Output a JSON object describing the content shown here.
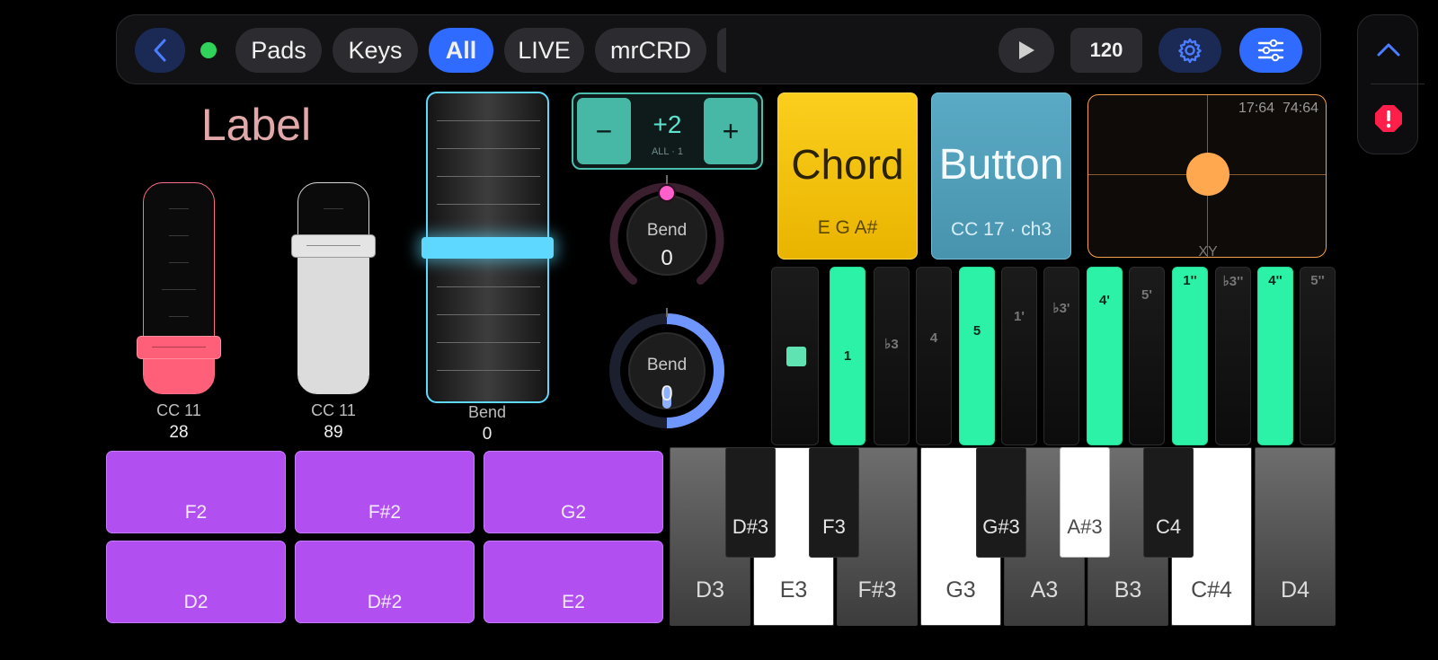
{
  "topbar": {
    "tabs": [
      "Pads",
      "Keys",
      "All",
      "LIVE",
      "mrCRD"
    ],
    "active_tab": "All",
    "tempo": "120",
    "accent_color": "#2f6bff",
    "status_color": "#2fd35a"
  },
  "label_widget": {
    "text": "Label"
  },
  "faders": [
    {
      "caption": "CC 11",
      "value": "28",
      "level": 0.2,
      "color": "#ff5f78"
    },
    {
      "caption": "CC 11",
      "value": "89",
      "level": 0.75,
      "color": "#dcdcdc"
    },
    {
      "caption": "Bend",
      "value": "0",
      "level": 0.5,
      "color": "#5fd8ff"
    }
  ],
  "stepper": {
    "value": "+2",
    "sub": "ALL · 1",
    "minus": "−",
    "plus": "+"
  },
  "knobs": [
    {
      "label": "Bend",
      "value": "0",
      "color": "#ff5fcb"
    },
    {
      "label": "Bend",
      "value": "0",
      "color": "#6f95ff"
    }
  ],
  "chord_tile": {
    "title": "Chord",
    "notes": "E G A#",
    "color": "#f7c21a"
  },
  "button_tile": {
    "title": "Button",
    "sub": "CC 17 · ch3",
    "color": "#5aa7c2"
  },
  "xy_pad": {
    "label": "XY",
    "readout": "17:64  74:64",
    "color": "#f6a050"
  },
  "scale_keys": [
    {
      "label": "",
      "on": false
    },
    {
      "label": "1",
      "on": true
    },
    {
      "label": "♭3",
      "on": false
    },
    {
      "label": "4",
      "on": false
    },
    {
      "label": "5",
      "on": true
    },
    {
      "label": "1'",
      "on": false
    },
    {
      "label": "♭3'",
      "on": false
    },
    {
      "label": "4'",
      "on": true
    },
    {
      "label": "5'",
      "on": false
    },
    {
      "label": "1''",
      "on": true
    },
    {
      "label": "♭3''",
      "on": false
    },
    {
      "label": "4''",
      "on": true
    },
    {
      "label": "5''",
      "on": false
    }
  ],
  "pads": [
    "F2",
    "F#2",
    "G2",
    "D2",
    "D#2",
    "E2"
  ],
  "piano": {
    "white_keys": [
      "D3",
      "E3",
      "F#3",
      "G3",
      "A3",
      "B3",
      "C#4",
      "D4"
    ],
    "white_lit": [
      false,
      true,
      false,
      true,
      false,
      false,
      true,
      false
    ],
    "black_keys": [
      "D#3",
      "F3",
      "G#3",
      "A#3",
      "C4"
    ],
    "black_lit": [
      false,
      false,
      false,
      true,
      false
    ]
  }
}
